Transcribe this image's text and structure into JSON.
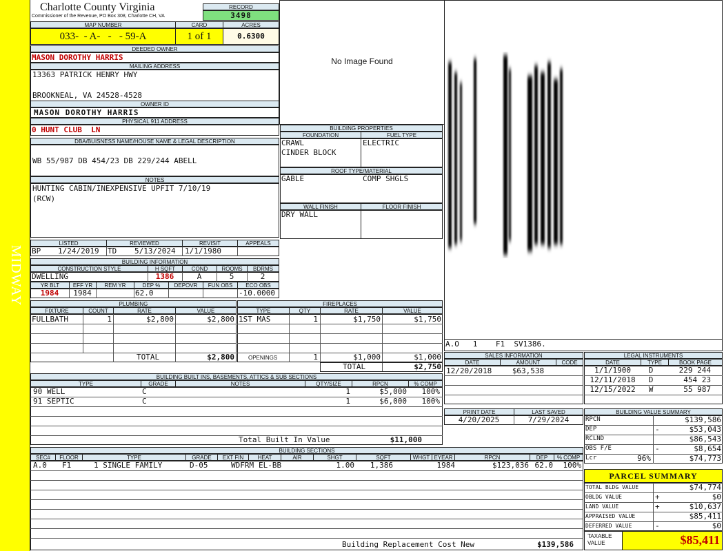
{
  "side_label": "MIDWAY",
  "header": {
    "county": "Charlotte County Virginia",
    "address": "Commissioner of the Revenue, PO Box 308, Charlotte CH, VA",
    "record_label": "RECORD",
    "record": "3498",
    "map_label": "MAP NUMBER",
    "map": "033-  - A-   -   - 59-A",
    "card_label": "CARD",
    "card": "1 of 1",
    "acres_label": "ACRES",
    "acres": "0.6300"
  },
  "owner": {
    "deeded_label": "DEEDED OWNER",
    "deeded": "MASON DOROTHY HARRIS",
    "mailing_label": "MAILING ADDRESS",
    "mail1": "13363 PATRICK HENRY HWY",
    "mail2": "BROOKNEAL, VA 24528-4528",
    "owner_id_label": "OWNER ID",
    "owner_id": "MASON DOROTHY HARRIS",
    "phys_label": "PHYSICAL 911 ADDRESS",
    "phys": "0 HUNT CLUB  LN",
    "legal_label": "DBA/BUISNESS NAME/HOUSE NAME & LEGAL DESCRIPTION",
    "legal": "WB 55/987 DB 454/23 DB 229/244 ABELL",
    "notes_label": "NOTES",
    "notes1": "HUNTING CABIN/INEXPENSIVE UPFIT 7/10/19",
    "notes2": "(RCW)"
  },
  "image": {
    "no_image": "No Image Found"
  },
  "building_props": {
    "title": "BUILDING PROPERTIES",
    "foundation_label": "FOUNDATION",
    "fuel_label": "FUEL TYPE",
    "foundation1": "CRAWL",
    "foundation2": "CINDER BLOCK",
    "fuel": "ELECTRIC",
    "roof_label": "ROOF TYPE/MATERIAL",
    "roof_type": "GABLE",
    "roof_mat": "COMP SHGLS",
    "wall_label": "WALL FINISH",
    "floor_label": "FLOOR FINISH",
    "wall": "DRY WALL",
    "floor": ""
  },
  "sketch": {
    "caption": "A.O   1    F1  SV1386."
  },
  "listing": {
    "listed_label": "LISTED",
    "reviewed_label": "REVIEWED",
    "revisit_label": "REVISIT",
    "appeals_label": "APPEALS",
    "listed_by": "BP",
    "listed": "1/24/2019",
    "reviewed_by": "TD",
    "reviewed": "5/13/2024",
    "revisit": "1/1/1980",
    "appeals": ""
  },
  "building_info": {
    "title": "BUILDING INFORMATION",
    "style_label": "CONSTRUCTION STYLE",
    "hsqft_label": "H SQFT",
    "cond_label": "COND",
    "rooms_label": "ROOMS",
    "bdrms_label": "BDRMS",
    "style": "DWELLING",
    "hsqft": "1386",
    "cond": "A",
    "rooms": "5",
    "bdrms": "2",
    "yrblt_label": "YR BLT",
    "effyr_label": "EFF YR",
    "remyr_label": "REM YR",
    "dep_label": "DEP %",
    "depovr_label": "DEPOVR",
    "funobs_label": "FUN OBS",
    "ecoobs_label": "ECO OBS",
    "yrblt": "1984",
    "effyr": "1984",
    "remyr": "",
    "dep": "62.0",
    "depovr": "",
    "funobs": "",
    "ecoobs": "-10.0000"
  },
  "plumbing": {
    "title": "PLUMBING",
    "h_fixture": "FIXTURE",
    "h_count": "COUNT",
    "h_rate": "RATE",
    "h_value": "VALUE",
    "rows": [
      {
        "fixture": "FULLBATH",
        "count": "1",
        "rate": "$2,800",
        "value": "$2,800"
      }
    ],
    "total_label": "TOTAL",
    "total": "$2,800"
  },
  "fireplaces": {
    "title": "FIREPLACES",
    "h_type": "TYPE",
    "h_qty": "QTY",
    "h_rate": "RATE",
    "h_value": "VALUE",
    "rows": [
      {
        "type": "1ST MAS",
        "qty": "1",
        "rate": "$1,750",
        "value": "$1,750"
      }
    ],
    "openings_label": "OPENINGS",
    "openings_qty": "1",
    "openings_rate": "$1,000",
    "openings_value": "$1,000",
    "total_label": "TOTAL",
    "total": "$2,750"
  },
  "builtins": {
    "title": "BUILDING BUILT INS, BASEMENTS, ATTICS & SUB SECTIONS",
    "h_type": "TYPE",
    "h_grade": "GRADE",
    "h_notes": "NOTES",
    "h_qty": "QTY/SIZE",
    "h_rpcn": "RPCN",
    "h_comp": "% COMP",
    "rows": [
      {
        "type": "90 WELL",
        "grade": "C",
        "notes": "",
        "qty": "1",
        "rpcn": "$5,000",
        "comp": "100%"
      },
      {
        "type": "91 SEPTIC",
        "grade": "C",
        "notes": "",
        "qty": "1",
        "rpcn": "$6,000",
        "comp": "100%"
      }
    ],
    "total_label": "Total Built In Value",
    "total": "$11,000"
  },
  "sales": {
    "title": "SALES INFORMATION",
    "h_date": "DATE",
    "h_amount": "AMOUNT",
    "h_code": "CODE",
    "rows": [
      {
        "date": "12/20/2018",
        "amount": "$63,538",
        "code": ""
      }
    ]
  },
  "dates": {
    "print_label": "PRINT DATE",
    "saved_label": "LAST SAVED",
    "print": "4/20/2025",
    "saved": "7/29/2024"
  },
  "legal_inst": {
    "title": "LEGAL INSTRUMENTS",
    "h_date": "DATE",
    "h_type": "TYPE",
    "h_book": "BOOK PAGE",
    "rows": [
      {
        "date": "1/1/1900",
        "type": "D",
        "book": "229 244"
      },
      {
        "date": "12/11/2018",
        "type": "D",
        "book": "454 23"
      },
      {
        "date": "12/15/2022",
        "type": "W",
        "book": "55 987"
      }
    ]
  },
  "bvs": {
    "title": "BUILDING VALUE SUMMARY",
    "rows": [
      {
        "label": "RPCN",
        "sign": "",
        "pct": "",
        "value": "$139,586"
      },
      {
        "label": "DEP",
        "sign": "-",
        "pct": "",
        "value": "$53,043"
      },
      {
        "label": "RCLND",
        "sign": "",
        "pct": "",
        "value": "$86,543"
      },
      {
        "label": "OBS F/E",
        "sign": "-",
        "pct": "",
        "value": "$8,654"
      },
      {
        "label": "Lcr",
        "sign": "",
        "pct": "96%",
        "value": "$74,773"
      }
    ]
  },
  "parcel": {
    "title": "PARCEL SUMMARY",
    "rows": [
      {
        "label": "TOTAL BLDG VALUE",
        "sign": "",
        "value": "$74,774"
      },
      {
        "label": "OBLDG VALUE",
        "sign": "+",
        "value": "$0"
      },
      {
        "label": "LAND VALUE",
        "sign": "+",
        "value": "$10,637"
      },
      {
        "label": "APPRAISED VALUE",
        "sign": "",
        "value": "$85,411"
      },
      {
        "label": "DEFERRED VALUE",
        "sign": "-",
        "value": "$0"
      }
    ],
    "taxable_label": "TAXABLE VALUE",
    "taxable": "$85,411"
  },
  "sections": {
    "title": "BUILDING SECTIONS",
    "h_sec": "SEC#",
    "h_floor": "FLOOR",
    "h_type": "TYPE",
    "h_grade": "GRADE",
    "h_extfin": "EXT FIN",
    "h_heat": "HEAT",
    "h_air": "AIR",
    "h_shgt": "SHGT",
    "h_sqft": "SQFT",
    "h_whgt": "WHGT",
    "h_eyear": "EYEAR",
    "h_rpcn": "RPCN",
    "h_dep": "DEP",
    "h_comp": "% COMP",
    "rows": [
      {
        "sec": "A.0",
        "floor": "F1",
        "type": "1 SINGLE FAMILY",
        "grade": "D-05",
        "extfin": "WDFRM",
        "heat": "EL-BB",
        "air": "",
        "shgt": "1.00",
        "sqft": "1,386",
        "whgt": "",
        "eyear": "1984",
        "rpcn": "$123,036",
        "dep": "62.0",
        "comp": "100%"
      }
    ],
    "total_label": "Building Replacement Cost New",
    "total": "$139,586"
  },
  "colors": {
    "side": "#ffff00",
    "header_bg": "#dbe9f1",
    "record_bg": "#7fe07f",
    "map_bg": "#ffff00",
    "red": "#c00000"
  }
}
